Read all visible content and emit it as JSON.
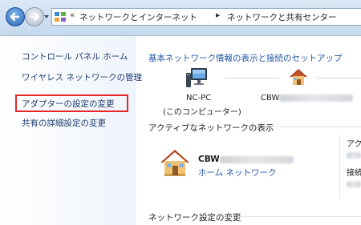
{
  "address": {
    "overflow": "«",
    "crumbs": [
      "ネットワークとインターネット",
      "ネットワークと共有センター"
    ],
    "separator": "▸"
  },
  "sidebar": {
    "items": [
      {
        "label": "コントロール パネル ホーム"
      },
      {
        "label": "ワイヤレス ネットワークの管理"
      },
      {
        "label": "アダプターの設定の変更",
        "highlighted": true
      },
      {
        "label": "共有の詳細設定の変更"
      }
    ],
    "highlight_color": "#e6262a"
  },
  "main": {
    "title": "基本ネットワーク情報の表示と接続のセットアップ",
    "map": {
      "pc_name": "NC-PC",
      "pc_caption": "(このコンピューター)",
      "network_prefix": "CBW"
    },
    "active_section": "アクティブなネットワークの表示",
    "network_name": "CBW",
    "network_type": "ホーム ネットワーク",
    "right_col": [
      "アク",
      "接続"
    ],
    "settings_section": "ネットワーク設定の変更"
  },
  "icons": [
    "back-arrow-icon",
    "forward-arrow-icon",
    "control-panel-icon",
    "computer-icon",
    "home-network-icon"
  ],
  "colors": {
    "link": "#1f54a6",
    "sidebar_link": "#1e3b6e",
    "highlight": "#e6262a"
  }
}
